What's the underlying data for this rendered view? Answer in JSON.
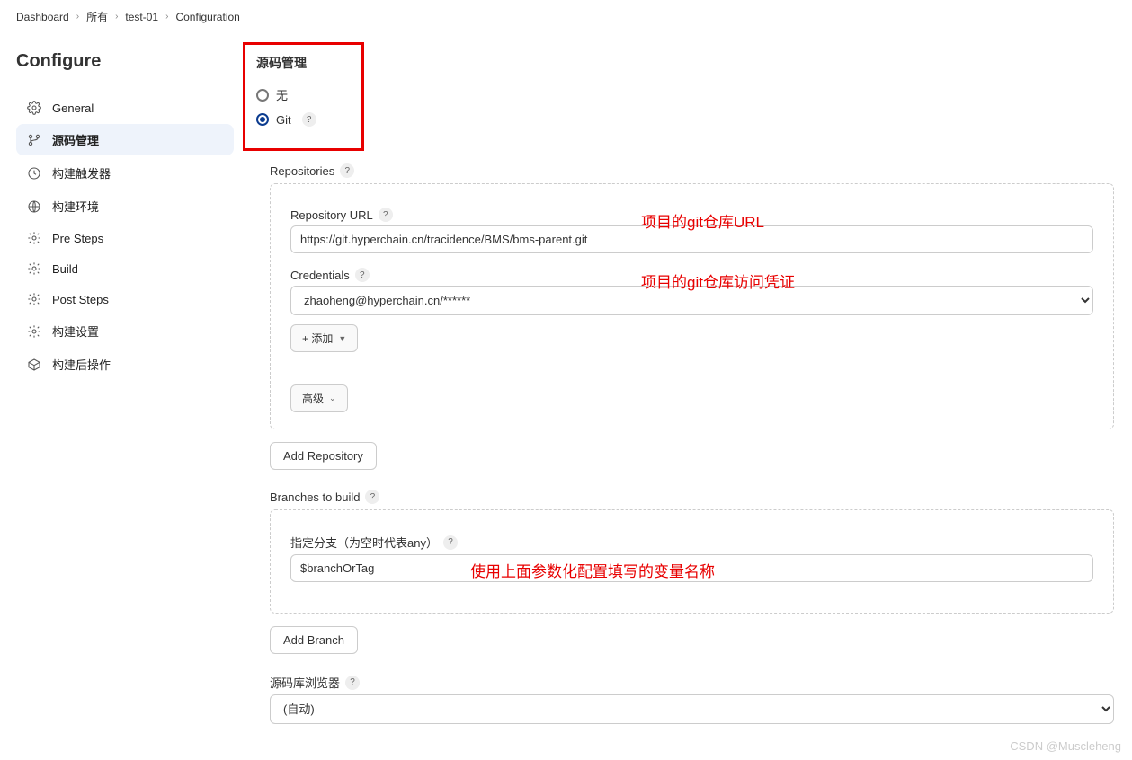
{
  "breadcrumb": [
    "Dashboard",
    "所有",
    "test-01",
    "Configuration"
  ],
  "page_title": "Configure",
  "nav": [
    {
      "label": "General",
      "icon": "gear"
    },
    {
      "label": "源码管理",
      "icon": "branch",
      "active": true
    },
    {
      "label": "构建触发器",
      "icon": "clock"
    },
    {
      "label": "构建环境",
      "icon": "globe"
    },
    {
      "label": "Pre Steps",
      "icon": "gear"
    },
    {
      "label": "Build",
      "icon": "gear"
    },
    {
      "label": "Post Steps",
      "icon": "gear"
    },
    {
      "label": "构建设置",
      "icon": "gear"
    },
    {
      "label": "构建后操作",
      "icon": "box"
    }
  ],
  "scm": {
    "title": "源码管理",
    "options": {
      "none": "无",
      "git": "Git"
    },
    "selected": "git"
  },
  "repositories": {
    "label": "Repositories",
    "repo_url_label": "Repository URL",
    "repo_url_value": "https://git.hyperchain.cn/tracidence/BMS/bms-parent.git",
    "credentials_label": "Credentials",
    "credentials_value": "zhaoheng@hyperchain.cn/******",
    "add_button": "+ 添加",
    "advanced_button": "高级",
    "add_repo_button": "Add Repository"
  },
  "branches": {
    "label": "Branches to build",
    "specifier_label": "指定分支（为空时代表any）",
    "specifier_value": "$branchOrTag",
    "add_branch_button": "Add Branch"
  },
  "browser": {
    "label": "源码库浏览器",
    "value": "(自动)"
  },
  "annotations": {
    "url": "项目的git仓库URL",
    "cred": "项目的git仓库访问凭证",
    "branch": "使用上面参数化配置填写的变量名称"
  },
  "watermark": "CSDN @Muscleheng"
}
